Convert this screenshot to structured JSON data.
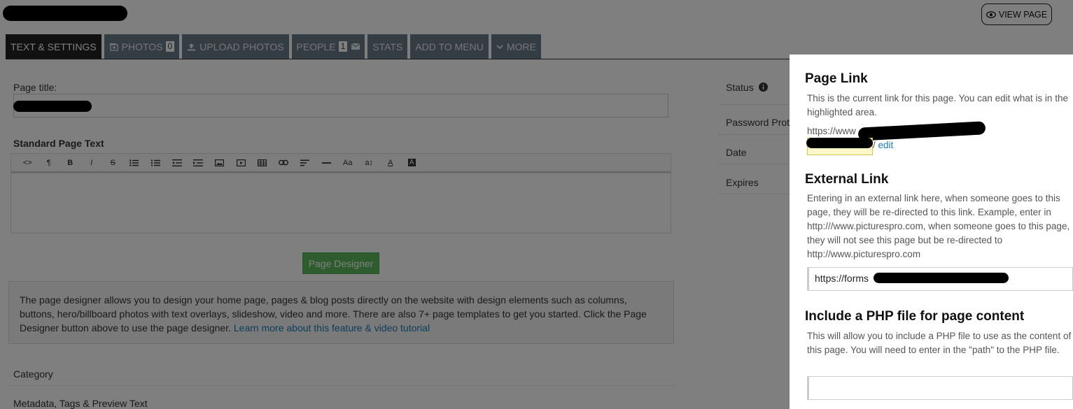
{
  "header": {
    "view_page_label": "VIEW PAGE"
  },
  "tabs": [
    {
      "label": "TEXT & SETTINGS"
    },
    {
      "label": "PHOTOS",
      "badge": "0"
    },
    {
      "label": "UPLOAD PHOTOS"
    },
    {
      "label": "PEOPLE",
      "badge": "1"
    },
    {
      "label": "STATS"
    },
    {
      "label": "ADD TO MENU"
    },
    {
      "label": "MORE"
    }
  ],
  "form": {
    "page_title_label": "Page title:",
    "standard_text_label": "Standard Page Text",
    "designer_button": "Page Designer",
    "designer_info": "The page designer allows you to design your home page, pages & blog posts directly on the website with design elements such as columns, buttons, hero/billboard photos with text overlays, slideshow, video and more. There are also 7+ page templates to get you started. Click the Page Designer button above to use the page designer.",
    "designer_link": "Learn more about this feature & video tutorial",
    "category_label": "Category",
    "metadata_label": "Metadata, Tags & Preview Text"
  },
  "settings": {
    "status_label": "Status",
    "password_label": "Password Prot",
    "date_label": "Date",
    "expires_label": "Expires"
  },
  "panel": {
    "page_link": {
      "title": "Page Link",
      "description": "This is the current link for this page. You can edit what is in the highlighted area.",
      "url_prefix": "https://www",
      "edit_label": "edit"
    },
    "external_link": {
      "title": "External Link",
      "description": "Entering in an external link here, when someone goes to this page, they will be re-directed to this link. Example, enter in http:///www.picturespro.com, when someone goes to this page, they will not see this page but be re-directed to http://www.picturespro.com",
      "value": "https://forms"
    },
    "php_include": {
      "title": "Include a PHP file for page content",
      "description": "This will allow you to include a PHP file to use as the content of this page. You will need to enter in the \"path\" to the PHP file.",
      "value": ""
    }
  }
}
